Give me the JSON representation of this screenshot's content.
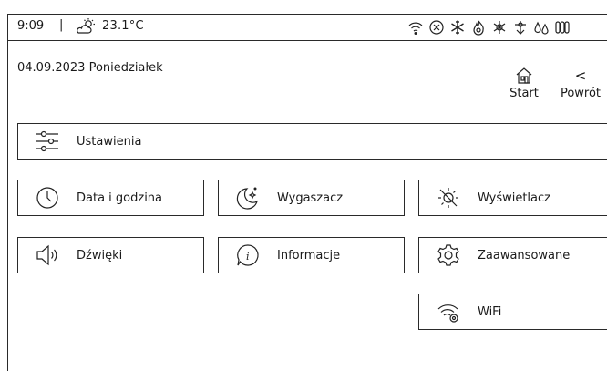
{
  "status": {
    "time": "9:09",
    "separator": "|",
    "temperature": "23.1°C",
    "weather_icon": "partly-cloudy-icon",
    "icons": [
      "wifi-icon",
      "error-circle-icon",
      "snowflake-icon",
      "flame-icon",
      "defrost-icon",
      "pump-icon",
      "water-drops-icon",
      "radiator-icon"
    ]
  },
  "header": {
    "date": "04.09.2023 Poniedziałek",
    "start_label": "Start",
    "back_label": "Powrót",
    "back_glyph": "<"
  },
  "settings_bar": {
    "label": "Ustawienia"
  },
  "tiles": {
    "date_time": "Data i godzina",
    "screensaver": "Wygaszacz",
    "display": "Wyświetlacz",
    "sounds": "Dźwięki",
    "info": "Informacje",
    "advanced": "Zaawansowane",
    "wifi": "WiFi"
  },
  "colors": {
    "line": "#2a2a2a",
    "background": "#ffffff",
    "text": "#1a1a1a"
  }
}
